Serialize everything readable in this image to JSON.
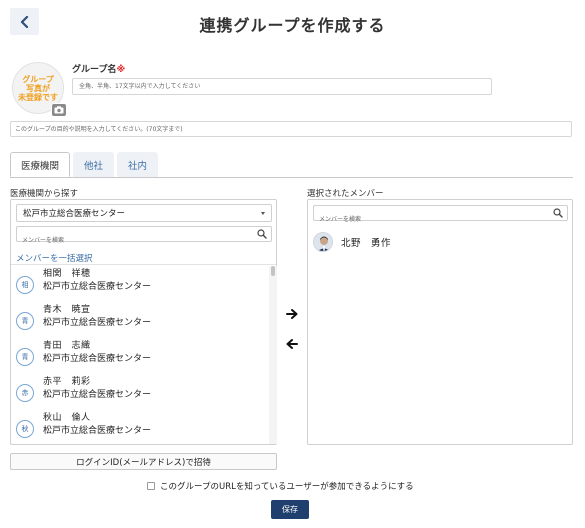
{
  "header": {
    "title": "連携グループを作成する"
  },
  "avatar": {
    "placeholder_text": "グループ\n写真が\n未登録です"
  },
  "form": {
    "name_label": "グループ名",
    "required_mark": "※",
    "name_placeholder": "全角、半角、17文字以内で入力してください",
    "description_placeholder": "このグループの目的や説明を入力してください。(70文字まで)"
  },
  "tabs": [
    {
      "label": "医療機関",
      "active": true
    },
    {
      "label": "他社",
      "active": false
    },
    {
      "label": "社内",
      "active": false
    }
  ],
  "left_panel": {
    "label": "医療機関から探す",
    "selected_institution": "松戸市立総合医療センター",
    "search_placeholder": "メンバーを検索",
    "select_all_label": "メンバーを一括選択",
    "members": [
      {
        "badge": "相",
        "name": "相関　祥穂",
        "org": "松戸市立総合医療センター"
      },
      {
        "badge": "青",
        "name": "青木　暁宣",
        "org": "松戸市立総合医療センター"
      },
      {
        "badge": "青",
        "name": "青田　志織",
        "org": "松戸市立総合医療センター"
      },
      {
        "badge": "赤",
        "name": "赤平　莉彩",
        "org": "松戸市立総合医療センター"
      },
      {
        "badge": "秋",
        "name": "秋山　倫人",
        "org": "松戸市立総合医療センター"
      }
    ]
  },
  "right_panel": {
    "label": "選択されたメンバー",
    "search_placeholder": "メンバーを検索",
    "selected_members": [
      {
        "name": "北野　勇作"
      }
    ]
  },
  "footer": {
    "invite_button": "ログインID(メールアドレス)で招待",
    "url_join_checkbox_label": "このグループのURLを知っているユーザーが参加できるようにする",
    "url_join_checked": false,
    "save_button": "保存"
  },
  "colors": {
    "accent": "#3a6ea5",
    "primary_button": "#1f3f6e",
    "required": "#e02020",
    "avatar_placeholder_text": "#f0a020"
  }
}
